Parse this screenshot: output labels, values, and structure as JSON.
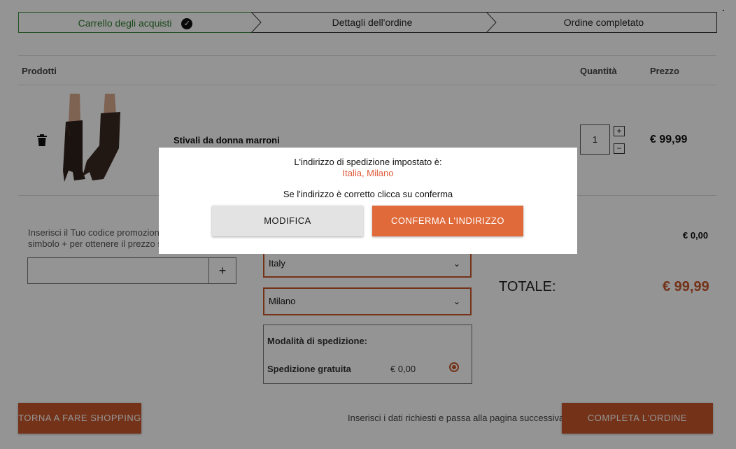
{
  "stepper": {
    "step1": "Carrello degli acquisti",
    "step2": "Dettagli dell'ordine",
    "step3": "Ordine completato"
  },
  "table": {
    "col_products": "Prodotti",
    "col_qty": "Quantità",
    "col_price": "Prezzo"
  },
  "item": {
    "name": "Stivali da donna marroni",
    "quantity": "1",
    "price": "€ 99,99",
    "image": "brown-boots"
  },
  "promo": {
    "text": "Inserisci il Tuo codice promoziona simbolo + per ottenere il prezzo s",
    "add_label": "+",
    "value": ""
  },
  "shipping": {
    "country": "Italy",
    "city": "Milano",
    "method_title": "Modalità di spedizione:",
    "option_label": "Spedizione gratuita",
    "option_price": "€ 0,00",
    "selected": true
  },
  "summary": {
    "discount": "€ 0,00",
    "total_label": "TOTALE:",
    "total_value": "€ 99,99"
  },
  "footer": {
    "back_label": "TORNA A FARE SHOPPING",
    "note": "Inserisci i dati richiesti e passa alla pagina successiva",
    "complete_label": "COMPLETA L'ORDINE"
  },
  "modal": {
    "title": "L'indirizzo di spedizione impostato è:",
    "address": "Italia, Milano",
    "note": "Se l'indirizzo è corretto clicca su conferma",
    "edit_label": "MODIFICA",
    "confirm_label": "CONFERMA L'INDIRIZZO"
  },
  "colors": {
    "accent": "#c8572a",
    "step_done": "#2e7d2e",
    "modal_address": "#e05a3a"
  }
}
